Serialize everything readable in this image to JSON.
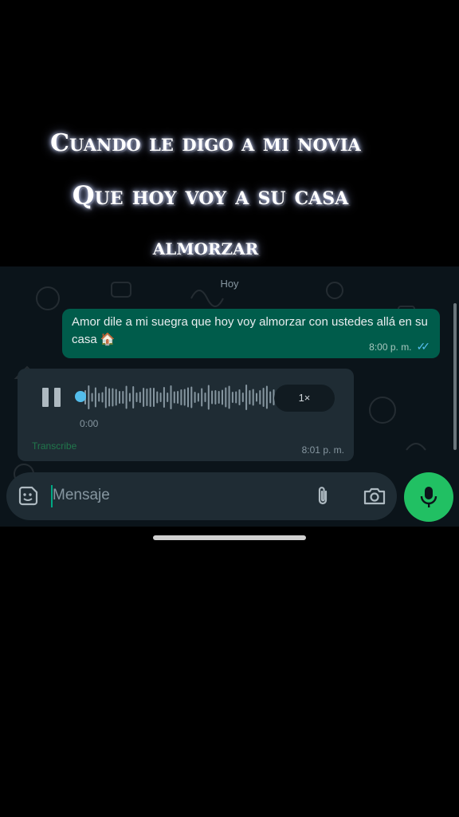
{
  "caption": {
    "line1": "Cuando le digo a mi novia",
    "line2": "Que hoy voy a su casa",
    "line3": "almorzar"
  },
  "chat": {
    "date_label": "Hoy",
    "outgoing_message": {
      "text": "Amor dile a mi suegra que hoy voy almorzar con ustedes allá en su casa 🏠",
      "time": "8:00 p. m.",
      "read_status_icon": "double-check-read"
    },
    "voice_message": {
      "duration": "0:00",
      "speed_label": "1×",
      "transcribe_label": "Transcribe",
      "time": "8:01 p. m.",
      "state": "playing"
    }
  },
  "composer": {
    "placeholder": "Mensaje",
    "icons": [
      "sticker-icon",
      "attach-icon",
      "camera-icon",
      "mic-icon"
    ]
  },
  "colors": {
    "chat_background": "#0b141a",
    "outgoing_bubble": "#005c4b",
    "incoming_bubble": "#1f2c34",
    "accent_green": "#21c063",
    "read_ticks": "#53bdeb"
  }
}
